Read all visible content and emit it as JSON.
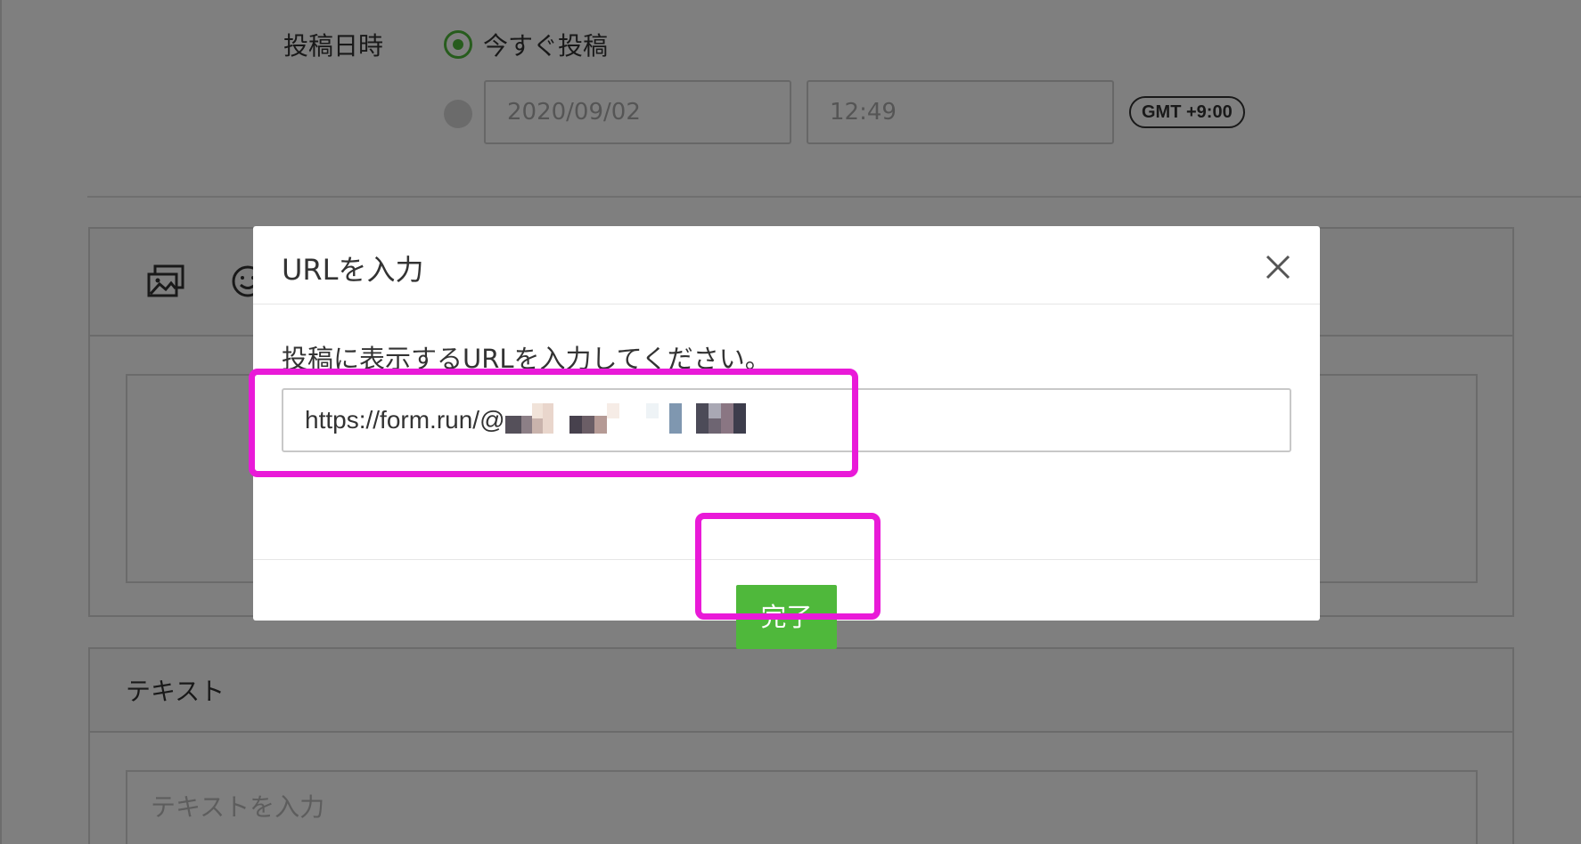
{
  "schedule": {
    "label": "投稿日時",
    "now_label": "今すぐ投稿",
    "date_value": "2020/09/02",
    "time_value": "12:49",
    "timezone": "GMT +9:00"
  },
  "media_toolbar": {
    "icons": [
      "photo-icon",
      "emoji-icon"
    ]
  },
  "text_section": {
    "title": "テキスト",
    "placeholder": "テキストを入力"
  },
  "modal": {
    "title": "URLを入力",
    "description": "投稿に表示するURLを入力してください。",
    "url_value": "https://form.run/@",
    "done_label": "完了",
    "close_icon": "close-icon"
  },
  "colors": {
    "accent_green": "#4fb83b",
    "highlight_magenta": "#e91ad8",
    "overlay": "rgba(0,0,0,0.5)"
  }
}
